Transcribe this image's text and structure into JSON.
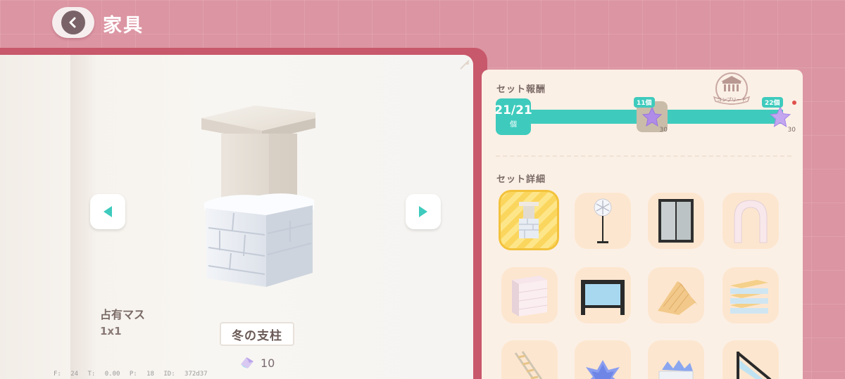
{
  "header": {
    "title": "家具",
    "back_icon": "chevron-left-icon"
  },
  "item": {
    "occupy_label": "占有マス",
    "occupy_value": "1x1",
    "name": "冬の支柱",
    "price": "10",
    "price_icon": "gem-icon"
  },
  "debug": {
    "text": "F: 24 T: 0.00 P: 18 ID: 372d37"
  },
  "set_reward": {
    "title": "セット報酬",
    "progress_count": "21/21",
    "progress_unit": "個",
    "progress_fraction": 1.0,
    "complete_badge": "コンプリート",
    "rewards": [
      {
        "threshold": "11個",
        "amount": "30",
        "icon": "purple-star-icon",
        "claimed": true
      },
      {
        "threshold": "22個",
        "amount": "30",
        "icon": "purple-star-icon",
        "claimed": false
      }
    ]
  },
  "set_detail": {
    "title": "セット詳細",
    "items": [
      {
        "name": "winter-pillar-icon",
        "selected": true
      },
      {
        "name": "snowflake-lamp-icon",
        "selected": false
      },
      {
        "name": "window-icon",
        "selected": false
      },
      {
        "name": "arch-icon",
        "selected": false
      },
      {
        "name": "block-wall-icon",
        "selected": false
      },
      {
        "name": "glass-fence-icon",
        "selected": false
      },
      {
        "name": "slide-icon",
        "selected": false
      },
      {
        "name": "stairs-icon",
        "selected": false
      },
      {
        "name": "ladder-icon",
        "selected": false
      },
      {
        "name": "blue-plant-icon",
        "selected": false
      },
      {
        "name": "flower-box-icon",
        "selected": false
      },
      {
        "name": "stair-rail-icon",
        "selected": false
      }
    ]
  },
  "colors": {
    "background": "#dc95a3",
    "teal": "#3ecbbd",
    "book_cover": "#c8586b",
    "panel": "#fbf0e6"
  }
}
